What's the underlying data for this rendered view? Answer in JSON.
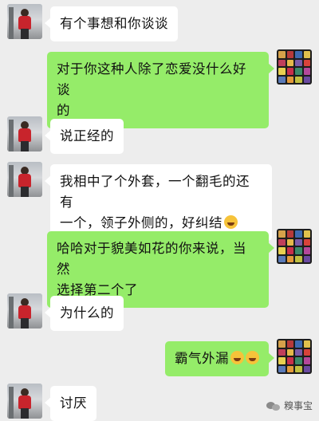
{
  "messages": [
    {
      "side": "left",
      "avatar": "girl-red-coat-avatar",
      "text": "有个事想和你谈谈"
    },
    {
      "side": "right",
      "avatar": "color-grid-avatar",
      "text_line1": "对于你这种人除了恋爱没什么好谈",
      "text_line2": "的"
    },
    {
      "side": "left",
      "avatar": "girl-red-coat-avatar",
      "text": "说正经的"
    },
    {
      "side": "left",
      "avatar": "girl-red-coat-avatar",
      "text_line1": "我相中了个外套，一个翻毛的还有",
      "text_line2": "一个，领子外侧的，好纠结",
      "emoji": "laughing-tears-emoji"
    },
    {
      "side": "right",
      "avatar": "color-grid-avatar",
      "text_line1": "哈哈对于貌美如花的你来说，当然",
      "text_line2": "选择第二个了"
    },
    {
      "side": "left",
      "avatar": "girl-red-coat-avatar",
      "text": "为什么的"
    },
    {
      "side": "right",
      "avatar": "color-grid-avatar",
      "text": "霸气外漏",
      "emoji": "smirk-emoji"
    },
    {
      "side": "left",
      "avatar": "girl-red-coat-avatar",
      "text": "讨厌"
    }
  ],
  "watermark": {
    "text": "糗事宝",
    "icon": "wechat-logo-icon"
  },
  "colors": {
    "background": "#ededed",
    "sent_bubble": "#95ec69",
    "received_bubble": "#ffffff"
  }
}
